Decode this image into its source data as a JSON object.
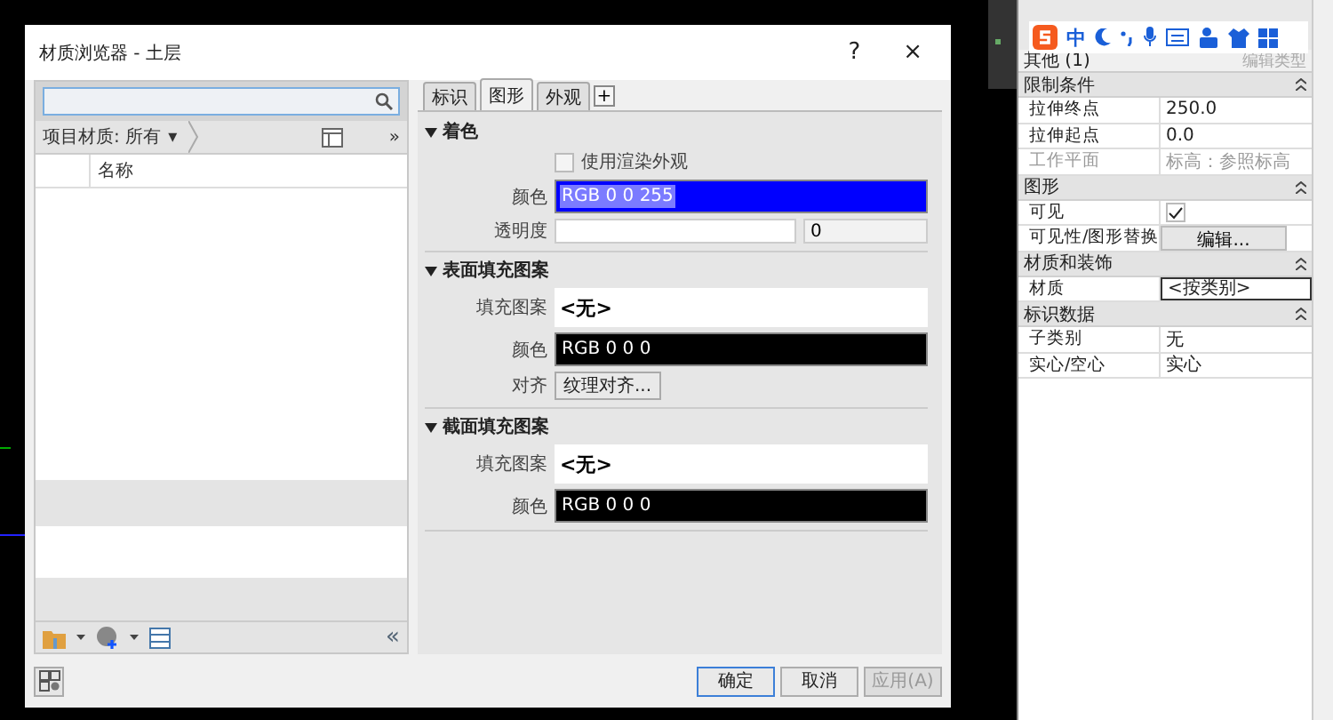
{
  "dialog": {
    "title": "材质浏览器 - 土层",
    "help": "?",
    "close": "×"
  },
  "browser": {
    "filter": "项目材质: 所有",
    "filter_caret": "▾",
    "more": "»",
    "columns": [
      "名称"
    ],
    "collapse": "«"
  },
  "tabs": [
    {
      "label": "标识",
      "selected": false
    },
    {
      "label": "图形",
      "selected": true
    },
    {
      "label": "外观",
      "selected": false
    }
  ],
  "add_tab": "+",
  "sections": [
    {
      "title": "着色",
      "expanded": true,
      "rows": [
        {
          "kind": "checkbox",
          "label": "使用渲染外观",
          "checked": false
        },
        {
          "kind": "color",
          "label": "颜色",
          "value": "RGB 0 0 255",
          "color": "#0000ff",
          "text_selected": true
        },
        {
          "kind": "slider",
          "label": "透明度",
          "level": 0,
          "value": "0"
        }
      ]
    },
    {
      "title": "表面填充图案",
      "expanded": true,
      "rows": [
        {
          "kind": "pattern",
          "label": "填充图案",
          "value": "<无>"
        },
        {
          "kind": "color",
          "label": "颜色",
          "value": "RGB 0 0 0",
          "color": "#000000",
          "text_selected": false
        },
        {
          "kind": "button",
          "label": "对齐",
          "value": "纹理对齐..."
        }
      ]
    },
    {
      "title": "截面填充图案",
      "expanded": true,
      "rows": [
        {
          "kind": "pattern",
          "label": "填充图案",
          "value": "<无>"
        },
        {
          "kind": "color",
          "label": "颜色",
          "value": "RGB 0 0 0",
          "color": "#000000",
          "text_selected": false
        }
      ]
    }
  ],
  "buttons": [
    {
      "label": "确定",
      "default": true,
      "disabled": false
    },
    {
      "label": "取消",
      "default": false,
      "disabled": false
    },
    {
      "label": "应用(A)",
      "default": false,
      "disabled": true
    }
  ],
  "ime": {
    "mode": "中"
  },
  "properties": {
    "type_selector": "其他 (1)",
    "edit_type": "编辑类型",
    "groups": [
      {
        "title": "限制条件",
        "rows": [
          {
            "kind": "text",
            "label": "拉伸终点",
            "value": "250.0",
            "disabled": false
          },
          {
            "kind": "text",
            "label": "拉伸起点",
            "value": "0.0",
            "disabled": false
          },
          {
            "kind": "text",
            "label": "工作平面",
            "value": "标高：参照标高",
            "disabled": true
          }
        ]
      },
      {
        "title": "图形",
        "rows": [
          {
            "kind": "checkbox",
            "label": "可见",
            "checked": true
          },
          {
            "kind": "button",
            "label": "可见性/图形替换",
            "value": "编辑..."
          }
        ]
      },
      {
        "title": "材质和装饰",
        "rows": [
          {
            "kind": "text",
            "label": "材质",
            "value": "<按类别>",
            "disabled": false,
            "focused": true
          }
        ]
      },
      {
        "title": "标识数据",
        "rows": [
          {
            "kind": "text",
            "label": "子类别",
            "value": "无",
            "disabled": false
          },
          {
            "kind": "text",
            "label": "实心/空心",
            "value": "实心",
            "disabled": false
          }
        ]
      }
    ]
  }
}
